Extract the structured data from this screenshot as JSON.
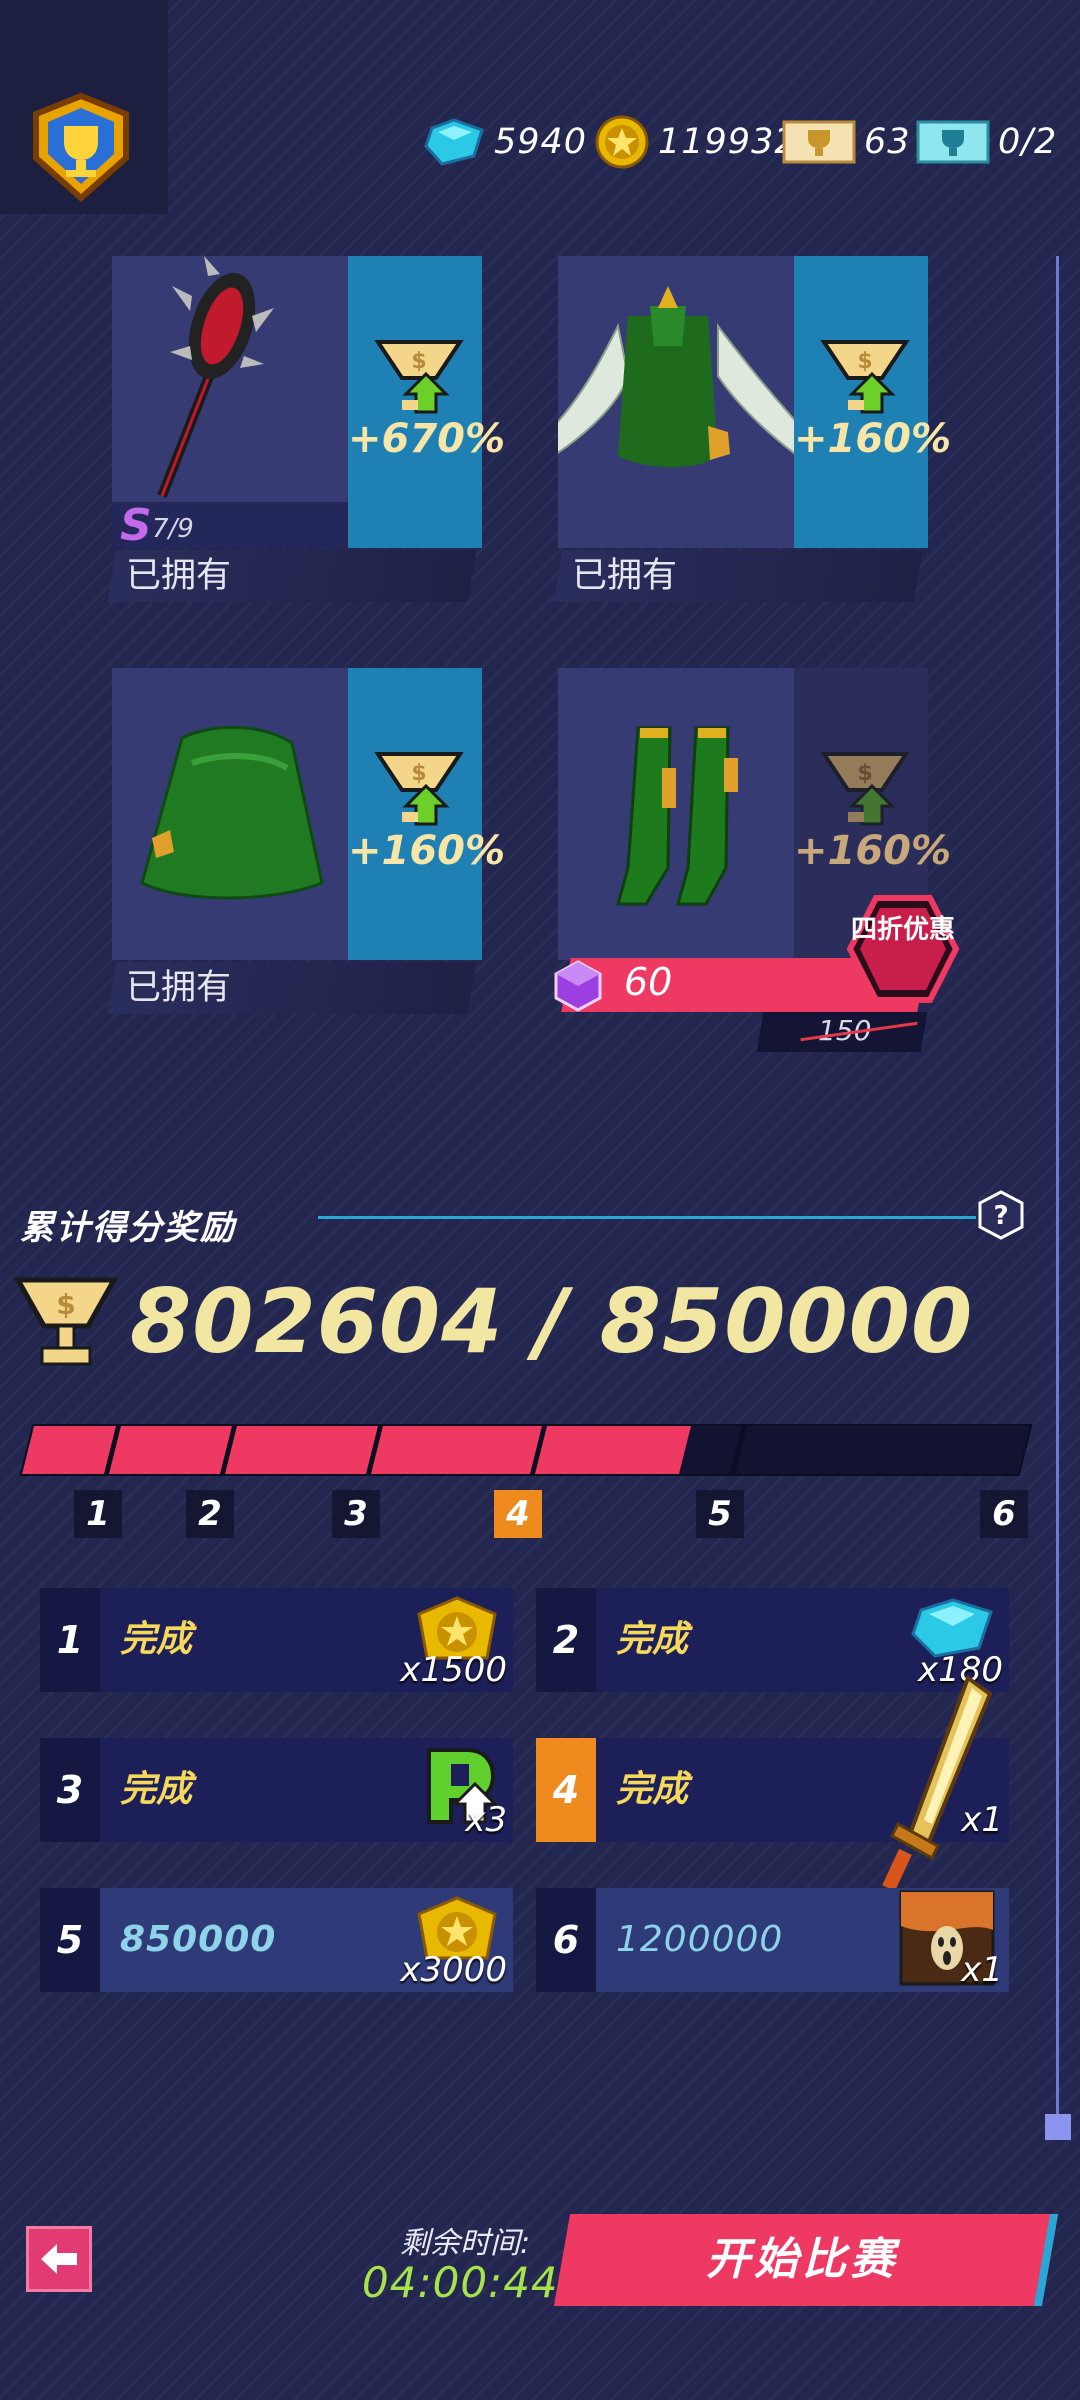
{
  "currency": [
    {
      "icon": "gem-icon",
      "value": "5940"
    },
    {
      "icon": "coin-icon",
      "value": "119932"
    },
    {
      "icon": "gold-ticket-icon",
      "value": "63"
    },
    {
      "icon": "cyan-ticket-icon",
      "value": "0/2"
    }
  ],
  "items": [
    {
      "name": "spiked-mace",
      "pct": "+670%",
      "status": "已拥有",
      "rank": "S",
      "rank_progress": "7/9"
    },
    {
      "name": "green-jacket",
      "pct": "+160%",
      "status": "已拥有"
    },
    {
      "name": "green-skirt",
      "pct": "+160%",
      "status": "已拥有"
    },
    {
      "name": "green-boots",
      "pct": "+160%",
      "price": "60",
      "old_price": "150",
      "discount": "四折优惠"
    }
  ],
  "rewards_section": {
    "title": "累计得分奖励",
    "score": "802604 / 850000",
    "progress_fraction": 0.66,
    "milestones": [
      "1",
      "2",
      "3",
      "4",
      "5",
      "6"
    ],
    "active_milestone": "4"
  },
  "rewards": [
    {
      "num": "1",
      "label": "完成",
      "count": "x1500",
      "icon": "coin-icon"
    },
    {
      "num": "2",
      "label": "完成",
      "count": "x180",
      "icon": "gem-icon"
    },
    {
      "num": "3",
      "label": "完成",
      "count": "x3",
      "icon": "p-upgrade-icon"
    },
    {
      "num": "4",
      "label": "完成",
      "count": "x1",
      "icon": "sword-icon"
    },
    {
      "num": "5",
      "label": "850000",
      "count": "x3000",
      "icon": "coin-icon"
    },
    {
      "num": "6",
      "label": "1200000",
      "count": "x1",
      "icon": "scream-painting-icon"
    }
  ],
  "bottom": {
    "remaining_label": "剩余时间:",
    "timer": "04:00:44",
    "start_button": "开始比赛"
  },
  "colors": {
    "accent_pink": "#ee3a63",
    "accent_blue": "#1e80b3",
    "gold_text": "#f1e7a2",
    "timer_green": "#a6e34c",
    "milestone_orange": "#ee8a1e"
  }
}
